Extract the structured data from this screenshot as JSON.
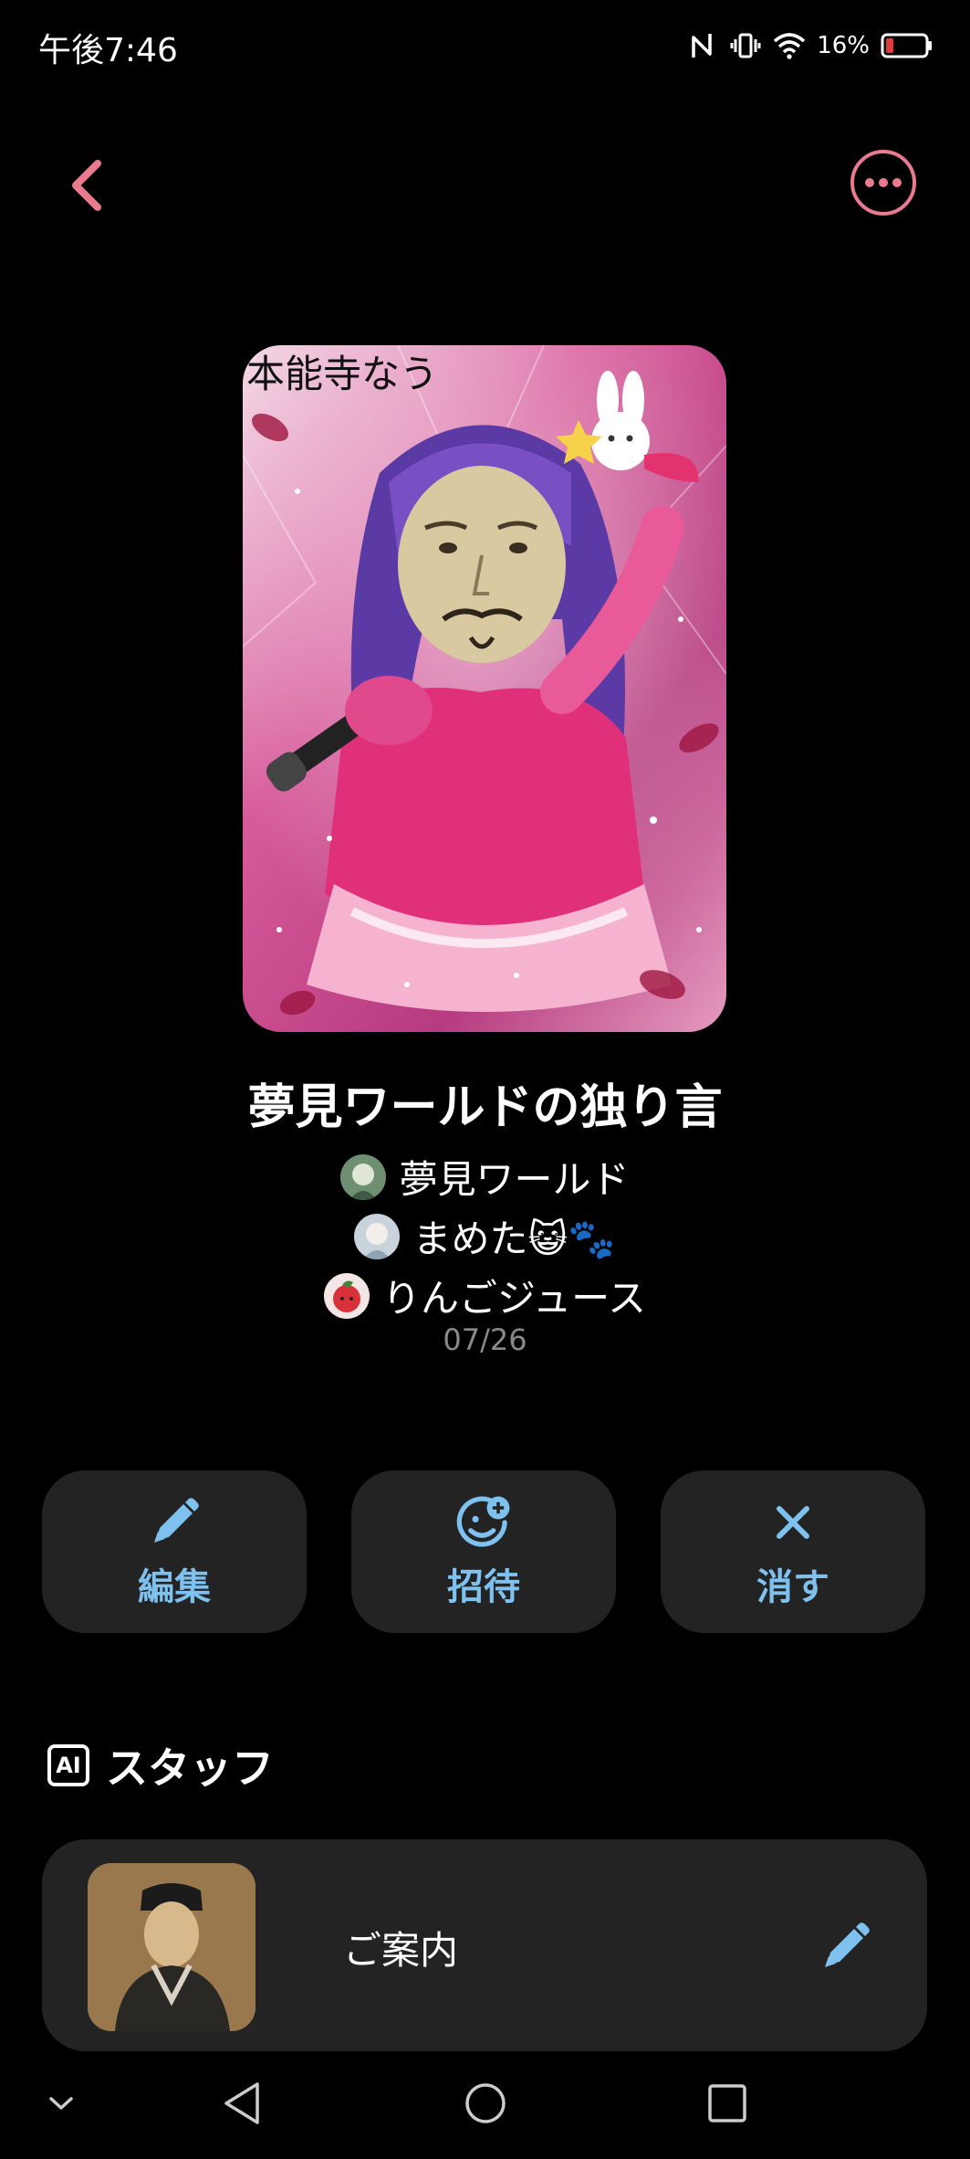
{
  "status_bar": {
    "time": "午後7:46",
    "battery_percent": "16%",
    "icons": [
      "nfc-icon",
      "vibrate-icon",
      "wifi-icon",
      "battery-low-icon"
    ]
  },
  "header": {
    "back_icon": "chevron-left-icon",
    "more_icon": "more-horizontal-icon",
    "accent_color": "#ea7a8e"
  },
  "cover": {
    "caption": "本能寺なう"
  },
  "album": {
    "title": "夢見ワールドの独り言",
    "members": [
      {
        "name": "夢見ワールド"
      },
      {
        "name": "まめた😺🐾"
      },
      {
        "name": "りんごジュース"
      }
    ],
    "date": "07/26"
  },
  "actions": [
    {
      "label": "編集",
      "icon": "pencil-icon"
    },
    {
      "label": "招待",
      "icon": "invite-face-plus-icon"
    },
    {
      "label": "消す",
      "icon": "close-icon"
    }
  ],
  "action_color": "#7ec1ee",
  "staff": {
    "badge": "AI",
    "title": "スタッフ",
    "items": [
      {
        "name": "ご案内",
        "icon": "pencil-icon"
      }
    ]
  },
  "nav": {
    "icons": [
      "chevron-down-icon",
      "back-triangle-icon",
      "home-circle-icon",
      "recents-square-icon"
    ]
  }
}
